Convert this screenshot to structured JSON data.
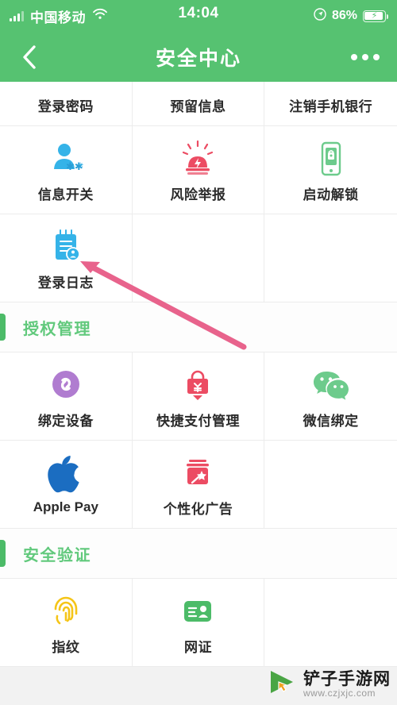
{
  "statusbar": {
    "carrier": "中国移动",
    "time": "14:04",
    "battery_percent": "86%",
    "signal_icon": "cellular-signal-icon",
    "wifi_icon": "wifi-icon",
    "location_icon": "location-arrow-icon",
    "charging_icon": "charging-bolt-icon"
  },
  "navbar": {
    "title": "安全中心",
    "back_icon": "back-chevron-icon",
    "more_icon": "more-dots-icon"
  },
  "colors": {
    "brand_green": "#56c271",
    "section_green": "#61c97c",
    "arrow_pink": "#e8638c",
    "blue": "#35b3e8",
    "red": "#ec4c63",
    "purple": "#b07cd0",
    "yellow": "#f5c518",
    "wechat_green": "#6dcb8c",
    "apple_blue": "#1b6dc1"
  },
  "rows": [
    {
      "clipped": true,
      "items": [
        {
          "label": "登录密码",
          "icon": "login-password-icon"
        },
        {
          "label": "预留信息",
          "icon": "reserved-info-icon"
        },
        {
          "label": "注销手机银行",
          "icon": "cancel-mobile-bank-icon"
        }
      ]
    },
    {
      "clipped": false,
      "items": [
        {
          "label": "信息开关",
          "icon": "info-switch-icon"
        },
        {
          "label": "风险举报",
          "icon": "risk-report-icon"
        },
        {
          "label": "启动解锁",
          "icon": "startup-unlock-icon"
        }
      ]
    },
    {
      "clipped": false,
      "items": [
        {
          "label": "登录日志",
          "icon": "login-log-icon"
        },
        {
          "label": "",
          "icon": ""
        },
        {
          "label": "",
          "icon": ""
        }
      ]
    }
  ],
  "section_auth": {
    "title": "授权管理",
    "rows": [
      {
        "items": [
          {
            "label": "绑定设备",
            "icon": "bound-device-icon"
          },
          {
            "label": "快捷支付管理",
            "icon": "quick-pay-lock-icon"
          },
          {
            "label": "微信绑定",
            "icon": "wechat-icon"
          }
        ]
      },
      {
        "items": [
          {
            "label": "Apple Pay",
            "icon": "apple-icon"
          },
          {
            "label": "个性化广告",
            "icon": "personalized-ads-icon"
          },
          {
            "label": "",
            "icon": ""
          }
        ]
      }
    ]
  },
  "section_verify": {
    "title": "安全验证",
    "rows": [
      {
        "items": [
          {
            "label": "指纹",
            "icon": "fingerprint-icon"
          },
          {
            "label": "网证",
            "icon": "net-id-card-icon"
          },
          {
            "label": "",
            "icon": ""
          }
        ]
      }
    ]
  },
  "annotation": {
    "arrow_icon": "pointer-arrow-annotation"
  },
  "watermark": {
    "name": "铲子手游网",
    "url": "www.czjxjc.com",
    "logo_icon": "play-cursor-logo-icon"
  }
}
